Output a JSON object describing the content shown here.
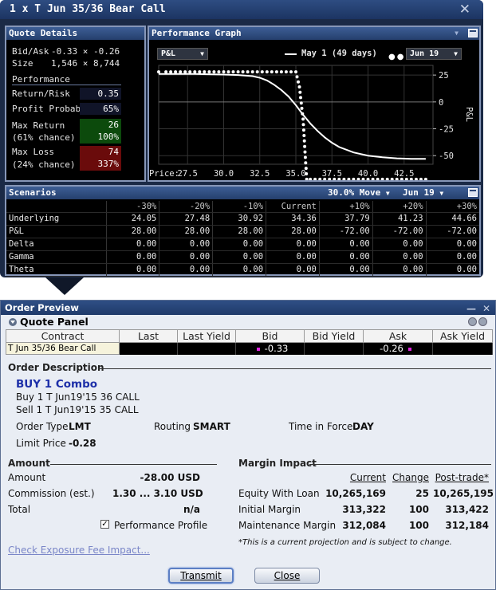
{
  "window": {
    "title": "1 x T Jun 35/36 Bear Call"
  },
  "quote_details": {
    "header": "Quote Details",
    "bid_ask_label": "Bid/Ask",
    "bid_ask_value": "-0.33 × -0.26",
    "size_label": "Size",
    "size_value": "1,546 × 8,744",
    "performance_label": "Performance",
    "return_risk_label": "Return/Risk",
    "return_risk_value": "0.35",
    "profit_prob_label": "Profit Probability",
    "profit_prob_value": "65%",
    "max_return_label": "Max Return",
    "max_return_chance": "(61% chance)",
    "max_return_value": "26",
    "max_return_pct": "100%",
    "max_loss_label": "Max Loss",
    "max_loss_chance": "(24% chance)",
    "max_loss_value": "74",
    "max_loss_pct": "337%",
    "colors": {
      "return_box": "#0c4a0c",
      "loss_box": "#6a0b0b",
      "ratio_box": "#101428"
    }
  },
  "performance_graph": {
    "header": "Performance Graph",
    "metric_select": "P&L",
    "legend_solid": "May 1 (49 days)",
    "date_select": "Jun 19",
    "price_label": "Price:",
    "y_axis_label": "P&L"
  },
  "chart_data": {
    "type": "line",
    "xlabel": "Price:",
    "ylabel": "P&L",
    "xlim": [
      25.5,
      44.5
    ],
    "ylim": [
      -58,
      34
    ],
    "x_ticks": [
      27.5,
      30.0,
      32.5,
      35.0,
      37.5,
      40.0,
      42.5
    ],
    "y_ticks": [
      25,
      0,
      -25,
      -50
    ],
    "grid": true,
    "series": [
      {
        "name": "May 1 (49 days)",
        "style": "solid",
        "x": [
          25.5,
          28,
          30,
          31,
          32,
          32.5,
          33,
          33.5,
          34,
          34.5,
          35,
          35.5,
          36,
          36.5,
          37,
          37.5,
          38,
          39,
          40,
          41,
          42,
          43,
          44
        ],
        "y": [
          26,
          26,
          25.5,
          25,
          24,
          22.5,
          20,
          16,
          11,
          5,
          -3,
          -12,
          -20,
          -27,
          -33,
          -38,
          -42,
          -47,
          -50,
          -51.5,
          -52.5,
          -53,
          -53
        ]
      },
      {
        "name": "Jun 19",
        "style": "dotted",
        "x": [
          25.5,
          26,
          27,
          28,
          29,
          30,
          31,
          32,
          33,
          34,
          35,
          35.25,
          35.5,
          35.75,
          36,
          37,
          38,
          39,
          40,
          41,
          42,
          43,
          44
        ],
        "y": [
          28,
          28,
          28,
          28,
          28,
          28,
          28,
          28,
          28,
          28,
          28,
          14,
          -16,
          -72,
          -72,
          -72,
          -72,
          -72,
          -72,
          -72,
          -72,
          -72,
          -72
        ]
      }
    ]
  },
  "scenarios": {
    "header": "Scenarios",
    "move_select": "30.0% Move",
    "date_select": "Jun 19",
    "columns": [
      "",
      "-30%",
      "-20%",
      "-10%",
      "Current",
      "+10%",
      "+20%",
      "+30%"
    ],
    "rows": [
      [
        "Underlying",
        "24.05",
        "27.48",
        "30.92",
        "34.36",
        "37.79",
        "41.23",
        "44.66"
      ],
      [
        "P&L",
        "28.00",
        "28.00",
        "28.00",
        "28.00",
        "-72.00",
        "-72.00",
        "-72.00"
      ],
      [
        "Delta",
        "0.00",
        "0.00",
        "0.00",
        "0.00",
        "0.00",
        "0.00",
        "0.00"
      ],
      [
        "Gamma",
        "0.00",
        "0.00",
        "0.00",
        "0.00",
        "0.00",
        "0.00",
        "0.00"
      ],
      [
        "Theta",
        "0.00",
        "0.00",
        "0.00",
        "0.00",
        "0.00",
        "0.00",
        "0.00"
      ]
    ]
  },
  "order_preview": {
    "title": "Order Preview",
    "quote_panel": {
      "title": "Quote Panel",
      "columns": [
        "Contract",
        "Last",
        "Last Yield",
        "Bid",
        "Bid Yield",
        "Ask",
        "Ask Yield"
      ],
      "row": [
        "T Jun 35/36 Bear Call",
        "",
        "",
        "-0.33",
        "",
        "-0.26",
        ""
      ]
    },
    "order_description": {
      "title": "Order Description",
      "combo": "BUY 1 Combo",
      "leg1": "Buy 1 T Jun19'15 36 CALL",
      "leg2": "Sell 1 T Jun19'15 35 CALL",
      "order_type_label": "Order Type",
      "order_type_value": "LMT",
      "routing_label": "Routing",
      "routing_value": "SMART",
      "tif_label": "Time in Force",
      "tif_value": "DAY",
      "limit_price_label": "Limit Price",
      "limit_price_value": "-0.28"
    },
    "amount": {
      "title": "Amount",
      "amount_label": "Amount",
      "amount_value": "-28.00 USD",
      "commission_label": "Commission (est.)",
      "commission_value": "1.30 ... 3.10 USD",
      "total_label": "Total",
      "total_value": "n/a",
      "performance_profile_label": "Performance Profile",
      "performance_profile_checked": true
    },
    "margin": {
      "title": "Margin Impact",
      "col_current": "Current",
      "col_change": "Change",
      "col_post": "Post-trade*",
      "rows": [
        {
          "label": "Equity With Loan",
          "current": "10,265,169",
          "change": "25",
          "post": "10,265,195"
        },
        {
          "label": "Initial Margin",
          "current": "313,322",
          "change": "100",
          "post": "313,422"
        },
        {
          "label": "Maintenance Margin",
          "current": "312,084",
          "change": "100",
          "post": "312,184"
        }
      ],
      "note": "*This is a current projection and is subject to change."
    },
    "exposure_link": "Check Exposure Fee Impact...",
    "transmit_label": "Transmit",
    "close_label": "Close"
  }
}
